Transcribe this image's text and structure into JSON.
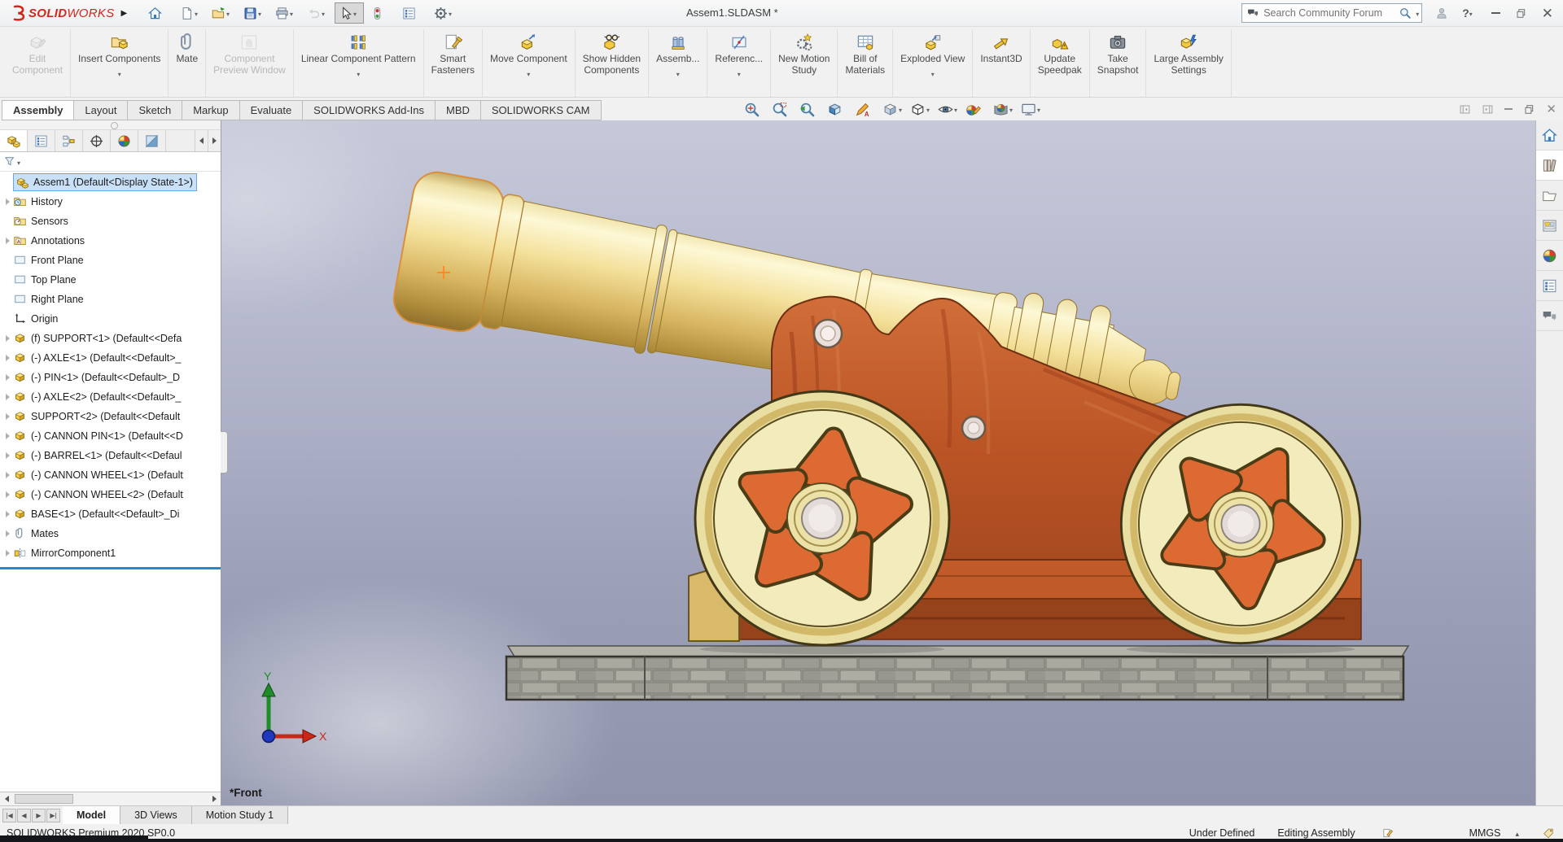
{
  "titlebar": {
    "logo": {
      "bold": "SOLID",
      "light": "WORKS"
    },
    "title": "Assem1.SLDASM *",
    "search": {
      "placeholder": "Search Community Forum"
    },
    "quick_access": [
      {
        "name": "home-button",
        "icon": "home-icon",
        "dd": "",
        "cls": ""
      },
      {
        "name": "new-document-button",
        "icon": "new-doc-icon",
        "dd": "dd",
        "cls": ""
      },
      {
        "name": "open-button",
        "icon": "open-icon",
        "dd": "dd",
        "cls": ""
      },
      {
        "name": "save-button",
        "icon": "save-icon",
        "dd": "dd",
        "cls": ""
      },
      {
        "name": "print-button",
        "icon": "print-icon",
        "dd": "dd",
        "cls": ""
      },
      {
        "name": "undo-button",
        "icon": "undo-icon",
        "dd": "dd",
        "cls": "disabled"
      },
      {
        "name": "select-tool-button",
        "icon": "select-cursor-icon",
        "dd": "dd",
        "cls": "active"
      },
      {
        "name": "rebuild-button",
        "icon": "rebuild-icon",
        "dd": "",
        "cls": ""
      },
      {
        "name": "options-button",
        "icon": "options-icon",
        "dd": "",
        "cls": ""
      },
      {
        "name": "settings-button",
        "icon": "settings-gear-icon",
        "dd": "dd",
        "cls": ""
      }
    ]
  },
  "ribbon": {
    "buttons": [
      {
        "label": "Edit\nComponent",
        "icon": "edit-component-icon",
        "dd": "",
        "cls": "disabled"
      },
      {
        "label": "Insert Components",
        "icon": "insert-components-icon",
        "dd": "dd",
        "cls": ""
      },
      {
        "label": "Mate",
        "icon": "mate-icon",
        "dd": "",
        "cls": ""
      },
      {
        "label": "Component\nPreview Window",
        "icon": "component-preview-icon",
        "dd": "",
        "cls": "disabled"
      },
      {
        "label": "Linear Component Pattern",
        "icon": "linear-pattern-icon",
        "dd": "dd",
        "cls": ""
      },
      {
        "label": "Smart\nFasteners",
        "icon": "smart-fasteners-icon",
        "dd": "",
        "cls": ""
      },
      {
        "label": "Move Component",
        "icon": "move-component-icon",
        "dd": "dd",
        "cls": ""
      },
      {
        "label": "Show Hidden\nComponents",
        "icon": "show-hidden-icon",
        "dd": "",
        "cls": ""
      },
      {
        "label": "Assemb...",
        "icon": "assembly-features-icon",
        "dd": "dd",
        "cls": ""
      },
      {
        "label": "Referenc...",
        "icon": "reference-geometry-icon",
        "dd": "dd",
        "cls": ""
      },
      {
        "label": "New Motion\nStudy",
        "icon": "new-motion-study-icon",
        "dd": "",
        "cls": ""
      },
      {
        "label": "Bill of\nMaterials",
        "icon": "bill-of-materials-icon",
        "dd": "",
        "cls": ""
      },
      {
        "label": "Exploded View",
        "icon": "exploded-view-icon",
        "dd": "dd",
        "cls": ""
      },
      {
        "label": "Instant3D",
        "icon": "instant3d-icon",
        "dd": "",
        "cls": ""
      },
      {
        "label": "Update\nSpeedpak",
        "icon": "update-speedpak-icon",
        "dd": "",
        "cls": ""
      },
      {
        "label": "Take\nSnapshot",
        "icon": "take-snapshot-icon",
        "dd": "",
        "cls": ""
      },
      {
        "label": "Large Assembly\nSettings",
        "icon": "large-assembly-settings-icon",
        "dd": "",
        "cls": ""
      }
    ]
  },
  "ribbon_tabs": [
    {
      "name": "tab-assembly",
      "label": "Assembly",
      "cls": "active"
    },
    {
      "name": "tab-layout",
      "label": "Layout",
      "cls": ""
    },
    {
      "name": "tab-sketch",
      "label": "Sketch",
      "cls": ""
    },
    {
      "name": "tab-markup",
      "label": "Markup",
      "cls": ""
    },
    {
      "name": "tab-evaluate",
      "label": "Evaluate",
      "cls": ""
    },
    {
      "name": "tab-solidworks-add-ins",
      "label": "SOLIDWORKS Add-Ins",
      "cls": ""
    },
    {
      "name": "tab-mbd",
      "label": "MBD",
      "cls": ""
    },
    {
      "name": "tab-solidworks-cam",
      "label": "SOLIDWORKS CAM",
      "cls": ""
    }
  ],
  "headsup": [
    {
      "name": "zoom-to-fit-button",
      "icon": "zoom-to-fit-icon",
      "dd": ""
    },
    {
      "name": "zoom-to-area-button",
      "icon": "zoom-to-area-icon",
      "dd": ""
    },
    {
      "name": "previous-view-button",
      "icon": "previous-view-icon",
      "dd": ""
    },
    {
      "name": "section-view-button",
      "icon": "section-view-icon",
      "dd": ""
    },
    {
      "name": "dynamic-annotation-button",
      "icon": "dynamic-annotation-views-icon",
      "dd": ""
    },
    {
      "name": "view-orientation-button",
      "icon": "view-orientation-icon",
      "dd": "dd"
    },
    {
      "name": "display-style-button",
      "icon": "display-style-icon",
      "dd": "dd"
    },
    {
      "name": "hide-show-items-button",
      "icon": "hide-show-items-icon",
      "dd": "dd"
    },
    {
      "name": "edit-appearance-button",
      "icon": "edit-appearance-icon",
      "dd": ""
    },
    {
      "name": "apply-scene-button",
      "icon": "apply-scene-icon",
      "dd": "dd"
    },
    {
      "name": "view-settings-button",
      "icon": "view-settings-icon",
      "dd": "dd"
    }
  ],
  "feature_manager": {
    "tabs": [
      {
        "name": "features-tab",
        "icon": "assembly-icon",
        "cls": "active"
      },
      {
        "name": "property-manager-tab",
        "icon": "property-manager-icon",
        "cls": ""
      },
      {
        "name": "configuration-manager-tab",
        "icon": "config-manager-icon",
        "cls": ""
      },
      {
        "name": "dimxpert-manager-tab",
        "icon": "dimxpert-icon",
        "cls": ""
      },
      {
        "name": "display-manager-tab",
        "icon": "appearance-ball-icon",
        "cls": ""
      },
      {
        "name": "cam-tab",
        "icon": "cam-tree-icon",
        "cls": ""
      }
    ],
    "root": {
      "icon": "assembly-icon",
      "label": "Assem1 (Default<Display State-1>)"
    },
    "items": [
      {
        "cls": "has-arrow",
        "icon": "history-folder-icon",
        "label": "History"
      },
      {
        "cls": "",
        "icon": "sensors-folder-icon",
        "label": "Sensors"
      },
      {
        "cls": "has-arrow",
        "icon": "annotations-folder-icon",
        "label": "Annotations"
      },
      {
        "cls": "",
        "icon": "plane-icon",
        "label": "Front Plane"
      },
      {
        "cls": "",
        "icon": "plane-icon",
        "label": "Top Plane"
      },
      {
        "cls": "",
        "icon": "plane-icon",
        "label": "Right Plane"
      },
      {
        "cls": "",
        "icon": "origin-icon",
        "label": "Origin"
      },
      {
        "cls": "has-arrow",
        "icon": "part-icon",
        "label": "(f) SUPPORT<1> (Default<<Defa"
      },
      {
        "cls": "has-arrow",
        "icon": "part-icon",
        "label": "(-) AXLE<1> (Default<<Default>_"
      },
      {
        "cls": "has-arrow",
        "icon": "part-icon",
        "label": "(-) PIN<1> (Default<<Default>_D"
      },
      {
        "cls": "has-arrow",
        "icon": "part-icon",
        "label": "(-) AXLE<2> (Default<<Default>_"
      },
      {
        "cls": "has-arrow",
        "icon": "part-icon",
        "label": "SUPPORT<2> (Default<<Default"
      },
      {
        "cls": "has-arrow",
        "icon": "part-icon",
        "label": "(-) CANNON PIN<1> (Default<<D"
      },
      {
        "cls": "has-arrow",
        "icon": "part-icon",
        "label": "(-) BARREL<1> (Default<<Defaul"
      },
      {
        "cls": "has-arrow",
        "icon": "part-icon",
        "label": "(-) CANNON WHEEL<1> (Default"
      },
      {
        "cls": "has-arrow",
        "icon": "part-icon",
        "label": "(-) CANNON WHEEL<2> (Default"
      },
      {
        "cls": "has-arrow",
        "icon": "part-icon",
        "label": "BASE<1> (Default<<Default>_Di"
      },
      {
        "cls": "has-arrow",
        "icon": "clip-icon",
        "label": "Mates"
      },
      {
        "cls": "has-arrow",
        "icon": "mirror-icon",
        "label": "MirrorComponent1"
      }
    ]
  },
  "viewport": {
    "view_label": "*Front",
    "triad": {
      "x": "X",
      "y": "Y"
    }
  },
  "task_pane": [
    {
      "name": "taskpane-home-button",
      "icon": "home-icon",
      "cls": ""
    },
    {
      "name": "design-library-button",
      "icon": "design-library-icon",
      "cls": "active"
    },
    {
      "name": "file-explorer-button",
      "icon": "file-explorer-icon",
      "cls": ""
    },
    {
      "name": "view-palette-button",
      "icon": "view-palette-icon",
      "cls": ""
    },
    {
      "name": "appearances-button",
      "icon": "appearance-ball-icon",
      "cls": ""
    },
    {
      "name": "custom-properties-button",
      "icon": "custom-properties-icon",
      "cls": ""
    },
    {
      "name": "forum-button",
      "icon": "forum-icon",
      "cls": ""
    }
  ],
  "bottom_tabs": [
    {
      "name": "tab-model",
      "label": "Model",
      "cls": "active"
    },
    {
      "name": "tab-3d-views",
      "label": "3D Views",
      "cls": ""
    },
    {
      "name": "tab-motion-study-1",
      "label": "Motion Study 1",
      "cls": ""
    }
  ],
  "status_bar": {
    "left": "SOLIDWORKS Premium 2020 SP0.0",
    "status": "Under Defined",
    "mode": "Editing Assembly",
    "units": "MMGS"
  }
}
